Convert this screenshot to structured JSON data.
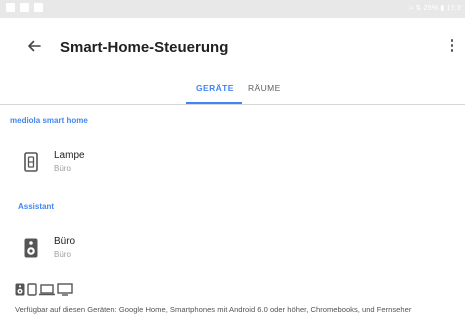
{
  "status_bar": {
    "right_text": "≈ ⇅ 25% ▮ 17:3"
  },
  "app_bar": {
    "back_icon": "arrow-back-icon",
    "title": "Smart-Home-Steuerung",
    "menu_icon": "more-vert-icon"
  },
  "tabs": [
    {
      "label": "GERÄTE",
      "selected": true
    },
    {
      "label": "RÄUME",
      "selected": false
    }
  ],
  "colors": {
    "accent": "#4285f4",
    "status_bar": "#e8e8e8",
    "secondary_text": "#9e9e9e"
  },
  "sections": [
    {
      "header": "mediola smart home",
      "devices": [
        {
          "name": "Lampe",
          "room": "Büro",
          "icon": "light-switch-icon"
        }
      ]
    },
    {
      "header": "Assistant",
      "devices": [
        {
          "name": "Büro",
          "room": "Büro",
          "icon": "speaker-icon"
        }
      ]
    }
  ],
  "footer": {
    "device_type_icons": [
      "speaker-icon",
      "phone-icon",
      "laptop-icon",
      "tv-icon"
    ],
    "availability_text": "Verfügbar auf diesen Geräten: Google Home, Smartphones mit Android 6.0 oder höher, Chromebooks, und Fernseher"
  }
}
